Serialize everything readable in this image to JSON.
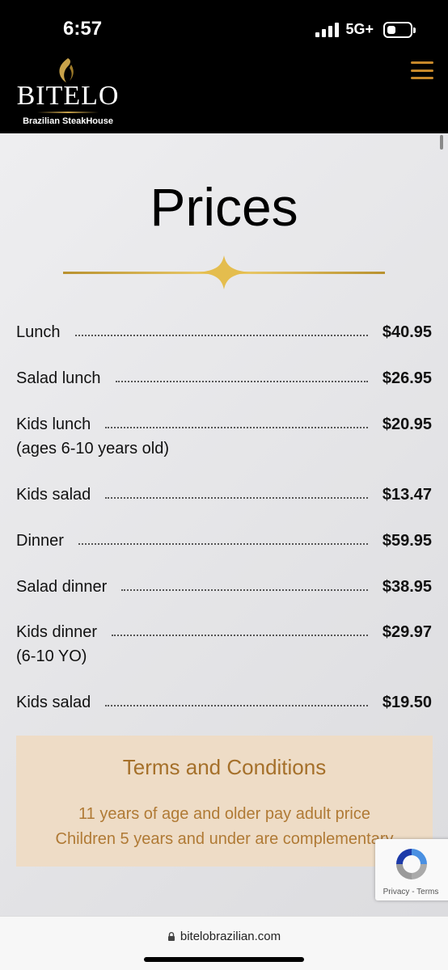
{
  "status_bar": {
    "time": "6:57",
    "network": "5G+"
  },
  "header": {
    "brand_name": "BITELO",
    "brand_subtitle": "Brazilian SteakHouse",
    "menu_icon": "hamburger-menu-icon",
    "accent_color": "#c7882a"
  },
  "page": {
    "title": "Prices"
  },
  "prices": [
    {
      "label": "Lunch",
      "price": "$40.95"
    },
    {
      "label": "Salad lunch",
      "price": "$26.95"
    },
    {
      "label": "Kids lunch",
      "sublabel": "(ages 6-10 years old)",
      "price": "$20.95"
    },
    {
      "label": "Kids salad",
      "price": "$13.47"
    },
    {
      "label": "Dinner",
      "price": "$59.95"
    },
    {
      "label": "Salad dinner",
      "price": "$38.95"
    },
    {
      "label": "Kids dinner",
      "sublabel": "(6-10 YO)",
      "price": "$29.97"
    },
    {
      "label": "Kids salad",
      "price": "$19.50"
    }
  ],
  "terms": {
    "title": "Terms and Conditions",
    "lines": [
      "11 years of age and older pay adult price",
      "Children 5 years and under are complementary"
    ],
    "background": "#eedcc6",
    "text_color": "#a5702a"
  },
  "recaptcha": {
    "privacy": "Privacy",
    "terms": "Terms"
  },
  "browser": {
    "url": "bitelobrazilian.com"
  }
}
